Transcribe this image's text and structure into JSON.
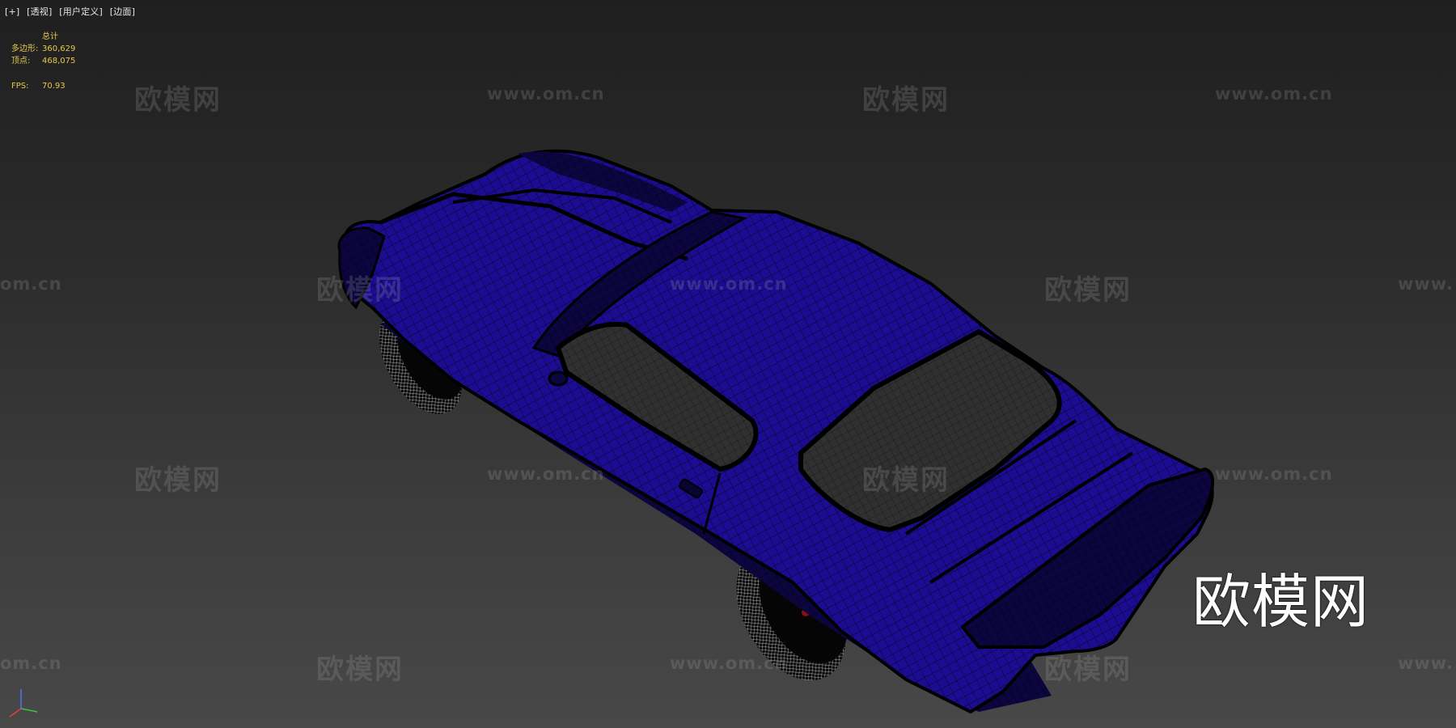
{
  "viewport": {
    "menu": {
      "plus": "[+]",
      "view": "[透视]",
      "shading_mode": "[用户定义]",
      "display": "[边面]"
    },
    "stats": {
      "header": "总计",
      "polys_label": "多边形:",
      "polys_value": "360,629",
      "verts_label": "顶点:",
      "verts_value": "468,075",
      "fps_label": "FPS:",
      "fps_value": "70.93"
    }
  },
  "watermarks": {
    "cn": "欧模网",
    "url": "www.om.cn",
    "url_partial_left": "om.cn",
    "url_partial_right": "www."
  },
  "big_logo": "欧模网",
  "colors": {
    "car_body": "#1a0b8c",
    "stats_text": "#e6c94a",
    "menu_text": "#e6e6e6",
    "gizmo_x": "#e04040",
    "gizmo_y": "#40c040",
    "gizmo_z": "#5070ff"
  },
  "icons": {
    "gizmo": "axis-gizmo-icon"
  }
}
